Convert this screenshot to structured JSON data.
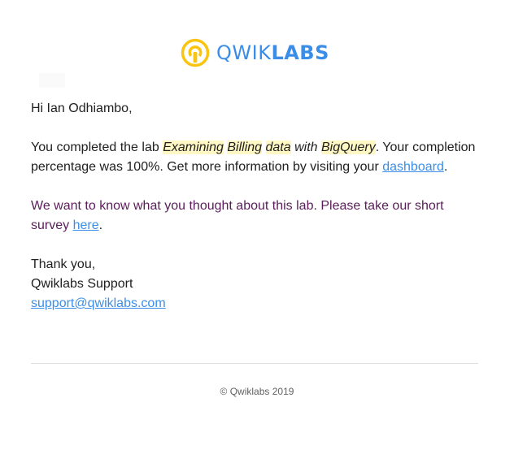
{
  "logo": {
    "word_qwik": "QWIK",
    "word_labs": "LABS",
    "brand_yellow": "#f9c510",
    "brand_blue": "#3b8ee8"
  },
  "email": {
    "greeting": "Hi Ian Odhiambo,",
    "completion": {
      "intro": "You completed the lab ",
      "lab_title_part1": "Examining",
      "lab_title_part2": "Billing",
      "lab_title_part3": "data",
      "lab_title_with": "with",
      "lab_title_part4": "BigQuery",
      "after_title": ". Your completion percentage was 100%. Get more information by visiting your ",
      "dashboard_link": "dashboard",
      "end": "."
    },
    "survey": {
      "text": "We want to know what you thought about this lab. Please take our short survey ",
      "link": "here",
      "end": "."
    },
    "signoff": {
      "thanks": "Thank you,",
      "team": "Qwiklabs Support",
      "email_link": "support@qwiklabs.com"
    }
  },
  "footer": {
    "copyright": "© Qwiklabs 2019"
  }
}
